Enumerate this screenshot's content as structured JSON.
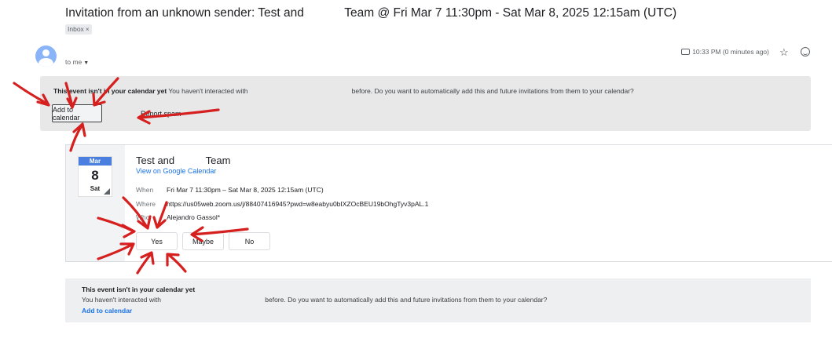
{
  "email": {
    "subject": "Invitation from an unknown sender: Test and            Team @ Fri Mar 7 11:30pm - Sat Mar 8, 2025 12:15am (UTC)",
    "label_chip": "Inbox",
    "label_chip_close": "×",
    "recipient": "to me",
    "timestamp": "10:33 PM (0 minutes ago)"
  },
  "banner_top": {
    "bold_text": "This event isn't in your calendar yet",
    "body_text": " You haven't interacted with                                                        before. Do you want to automatically add this and future invitations from them to your calendar?",
    "add_button": "Add to calendar",
    "spam_button": "Report spam"
  },
  "event": {
    "month": "Mar",
    "day": "8",
    "weekday": "Sat",
    "title": "Test and           Team",
    "view_link": "View on Google Calendar",
    "when_label": "When",
    "when_value": "Fri Mar 7 11:30pm – Sat Mar 8, 2025 12:15am (UTC)",
    "where_label": "Where",
    "where_value": "https://us05web.zoom.us/j/88407416945?pwd=w8eabyu0bIXZOcBEU19bOhgTyv3pAL.1",
    "who_label": "Who",
    "who_value": "Alejandro Gassol*",
    "rsvp": {
      "yes": "Yes",
      "maybe": "Maybe",
      "no": "No"
    }
  },
  "banner_bottom": {
    "title": "This event isn't in your calendar yet",
    "body": "You haven't interacted with                                                        before. Do you want to automatically add this and future invitations from them to your calendar?",
    "link": "Add to calendar"
  },
  "colors": {
    "annotation": "#d61f1f",
    "link": "#1a73e8",
    "calendar_month": "#4a7fe0"
  },
  "icons": [
    "avatar-icon",
    "label-icon",
    "star-icon",
    "emoji-icon",
    "calendar-date-icon"
  ]
}
